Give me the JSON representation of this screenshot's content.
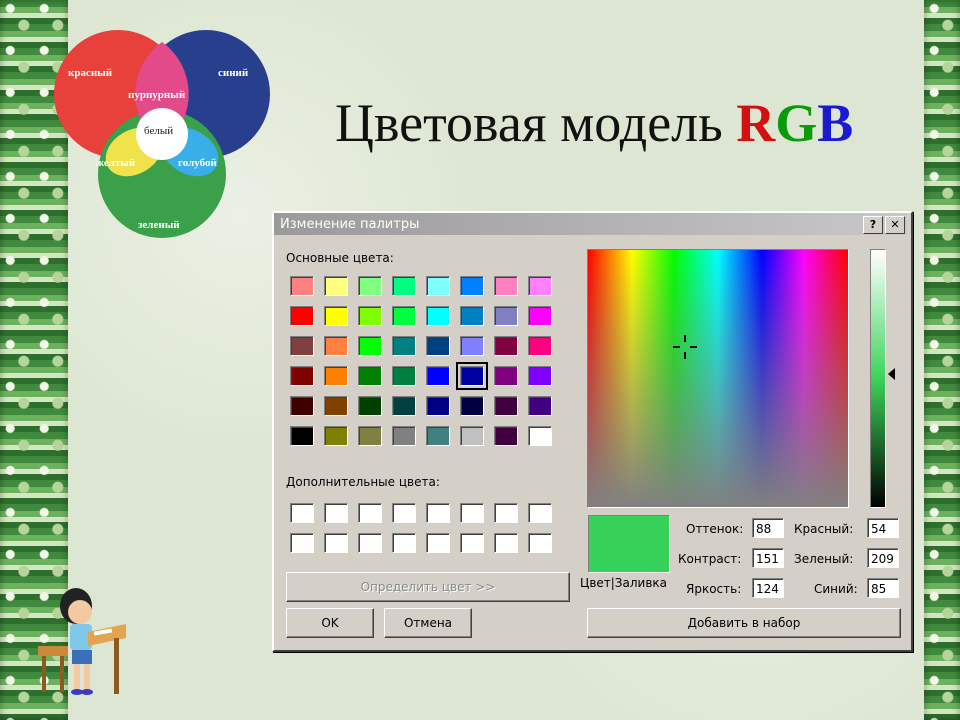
{
  "venn": {
    "labels": {
      "red": "красный",
      "blue": "синий",
      "magenta": "пурпурный",
      "white": "белый",
      "yellow": "желтый",
      "cyan": "голубой",
      "green": "зеленый"
    },
    "colors": {
      "red": "#e8403a",
      "blue": "#283f8e",
      "green": "#3aa04a",
      "magenta": "#e24a8a",
      "yellow": "#f0e24a",
      "cyan": "#3aaee8"
    }
  },
  "title": {
    "text": "Цветовая модель ",
    "r": "R",
    "g": "G",
    "b": "B"
  },
  "dialog": {
    "title": "Изменение палитры",
    "help_label": "?",
    "close_label": "✕",
    "basic_colors_label": "Основные цвета:",
    "custom_colors_label": "Дополнительные цвета:",
    "basic_colors": [
      [
        "#ff8080",
        "#ffff80",
        "#80ff80",
        "#00ff80",
        "#80ffff",
        "#0080ff",
        "#ff80c0",
        "#ff80ff"
      ],
      [
        "#ff0000",
        "#ffff00",
        "#80ff00",
        "#00ff40",
        "#00ffff",
        "#0080c0",
        "#8080c0",
        "#ff00ff"
      ],
      [
        "#804040",
        "#ff8040",
        "#00ff00",
        "#008080",
        "#004080",
        "#8080ff",
        "#800040",
        "#ff0080"
      ],
      [
        "#800000",
        "#ff8000",
        "#008000",
        "#008040",
        "#0000ff",
        "#0000a0",
        "#800080",
        "#8000ff"
      ],
      [
        "#400000",
        "#804000",
        "#004000",
        "#004040",
        "#000080",
        "#000040",
        "#400040",
        "#400080"
      ],
      [
        "#000000",
        "#808000",
        "#808040",
        "#808080",
        "#408080",
        "#c0c0c0",
        "#400040",
        "#ffffff"
      ]
    ],
    "selected_swatch": "#0000a0",
    "define_button": "Определить цвет >>",
    "ok_button": "OK",
    "cancel_button": "Отмена",
    "preview_label": "Цвет|Заливка",
    "preview_color": "#36d159",
    "hue_label": "Оттенок:",
    "hue_value": "88",
    "sat_label": "Контраст:",
    "sat_value": "151",
    "lum_label": "Яркость:",
    "lum_value": "124",
    "red_label": "Красный:",
    "red_value": "54",
    "green_label": "Зеленый:",
    "green_value": "209",
    "blue_label": "Синий:",
    "blue_value": "85",
    "add_button": "Добавить в набор"
  }
}
